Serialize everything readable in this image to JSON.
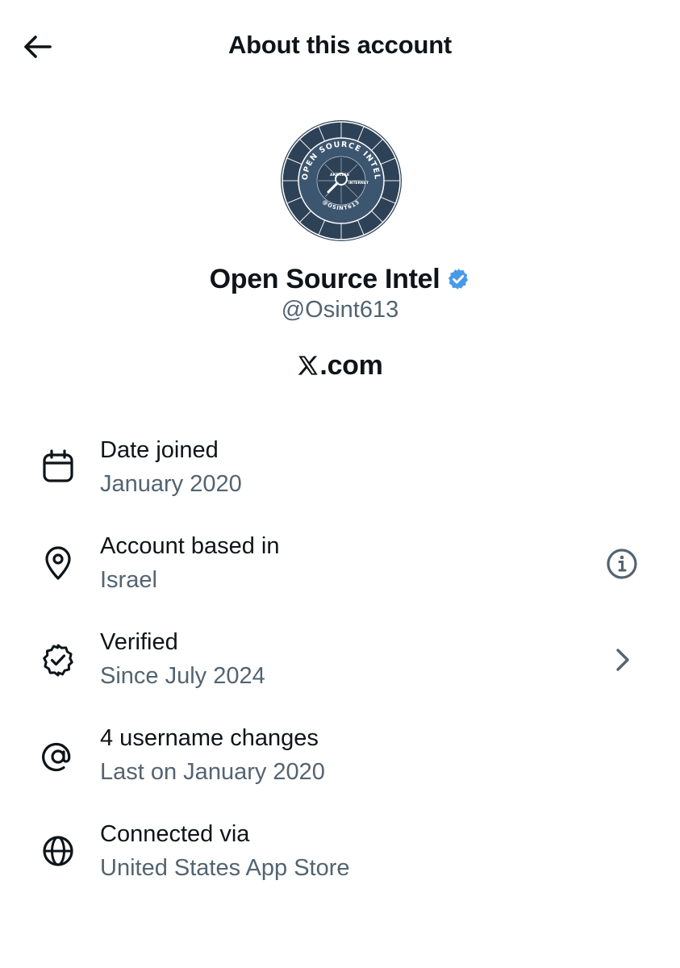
{
  "header": {
    "title": "About this account",
    "back_icon": "arrow-left-icon"
  },
  "profile": {
    "avatar": {
      "ring_text_top": "OPEN SOURCE INTEL",
      "ring_text_bottom": "@OSINT613",
      "center_labels": [
        "ARTICLES",
        "INTERNET"
      ]
    },
    "display_name": "Open Source Intel",
    "badge_icon": "verified-badge-icon",
    "badge_color": "#4a99e9",
    "handle": "@Osint613",
    "platform_logo": "X",
    "platform_suffix": ".com"
  },
  "details": [
    {
      "icon": "calendar-icon",
      "title": "Date joined",
      "value": "January 2020",
      "action_icon": null
    },
    {
      "icon": "location-pin-icon",
      "title": "Account based in",
      "value": "Israel",
      "action_icon": "info-icon"
    },
    {
      "icon": "verified-outline-icon",
      "title": "Verified",
      "value": "Since July 2024",
      "action_icon": "chevron-right-icon"
    },
    {
      "icon": "at-sign-icon",
      "title": "4 username changes",
      "value": "Last on January 2020",
      "action_icon": null
    },
    {
      "icon": "globe-icon",
      "title": "Connected via",
      "value": "United States App Store",
      "action_icon": null
    }
  ],
  "colors": {
    "text_primary": "#0f1419",
    "text_secondary": "#536471",
    "avatar_dark": "#2e4257"
  }
}
